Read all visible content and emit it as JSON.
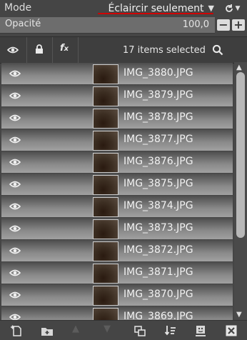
{
  "mode": {
    "label": "Mode",
    "value": "Éclaircir seulement"
  },
  "opacity": {
    "label": "Opacité",
    "value": "100,0",
    "fraction": 1.0
  },
  "header": {
    "selection_text": "17 items selected"
  },
  "layers": [
    {
      "name": "IMG_3880.JPG"
    },
    {
      "name": "IMG_3879.JPG"
    },
    {
      "name": "IMG_3878.JPG"
    },
    {
      "name": "IMG_3877.JPG"
    },
    {
      "name": "IMG_3876.JPG"
    },
    {
      "name": "IMG_3875.JPG"
    },
    {
      "name": "IMG_3874.JPG"
    },
    {
      "name": "IMG_3873.JPG"
    },
    {
      "name": "IMG_3872.JPG"
    },
    {
      "name": "IMG_3871.JPG"
    },
    {
      "name": "IMG_3870.JPG"
    },
    {
      "name": "IMG_3869.JPG"
    }
  ],
  "colors": {
    "mode_underline": "#d00000",
    "panel_bg": "#454545"
  },
  "icons": {
    "header": [
      "eye-icon",
      "lock-icon",
      "fx-icon",
      "search-icon"
    ],
    "bottom": [
      "new-layer-icon",
      "new-group-icon",
      "raise-layer-icon",
      "lower-layer-icon",
      "duplicate-layer-icon",
      "merge-down-icon",
      "add-mask-icon",
      "delete-layer-icon"
    ]
  }
}
